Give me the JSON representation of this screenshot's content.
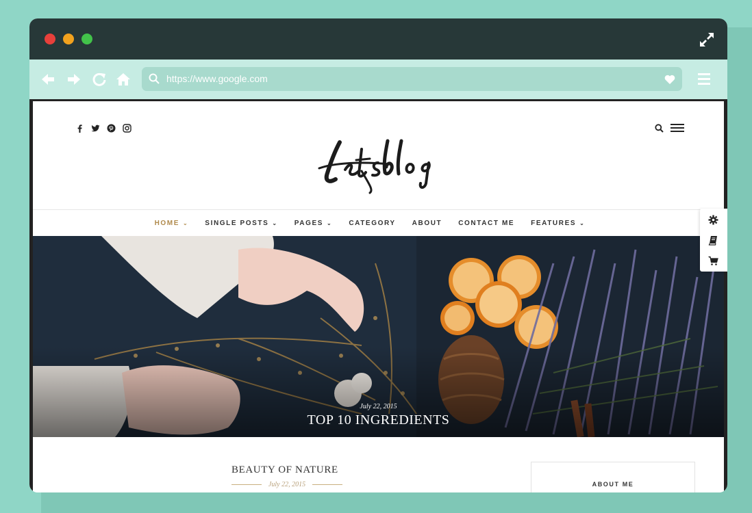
{
  "browser": {
    "url": "https://www.google.com"
  },
  "header": {
    "logo_text": "Letsblog",
    "social_icons": [
      "facebook-icon",
      "twitter-icon",
      "pinterest-icon",
      "instagram-icon"
    ]
  },
  "nav": {
    "items": [
      {
        "label": "HOME",
        "has_dropdown": true,
        "active": true
      },
      {
        "label": "SINGLE POSTS",
        "has_dropdown": true
      },
      {
        "label": "PAGES",
        "has_dropdown": true
      },
      {
        "label": "CATEGORY",
        "has_dropdown": false
      },
      {
        "label": "ABOUT",
        "has_dropdown": false
      },
      {
        "label": "CONTACT ME",
        "has_dropdown": false
      },
      {
        "label": "FEATURES",
        "has_dropdown": true
      }
    ]
  },
  "hero": {
    "date": "July 22, 2015",
    "title": "TOP 10 INGREDIENTS"
  },
  "post": {
    "title": "BEAUTY OF NATURE",
    "date": "July 22, 2015"
  },
  "sidebar": {
    "about_heading": "ABOUT ME"
  },
  "colors": {
    "background": "#8fd6c6",
    "titlebar": "#273838",
    "toolbar": "#c6ece3",
    "accent": "#b08a4c"
  }
}
